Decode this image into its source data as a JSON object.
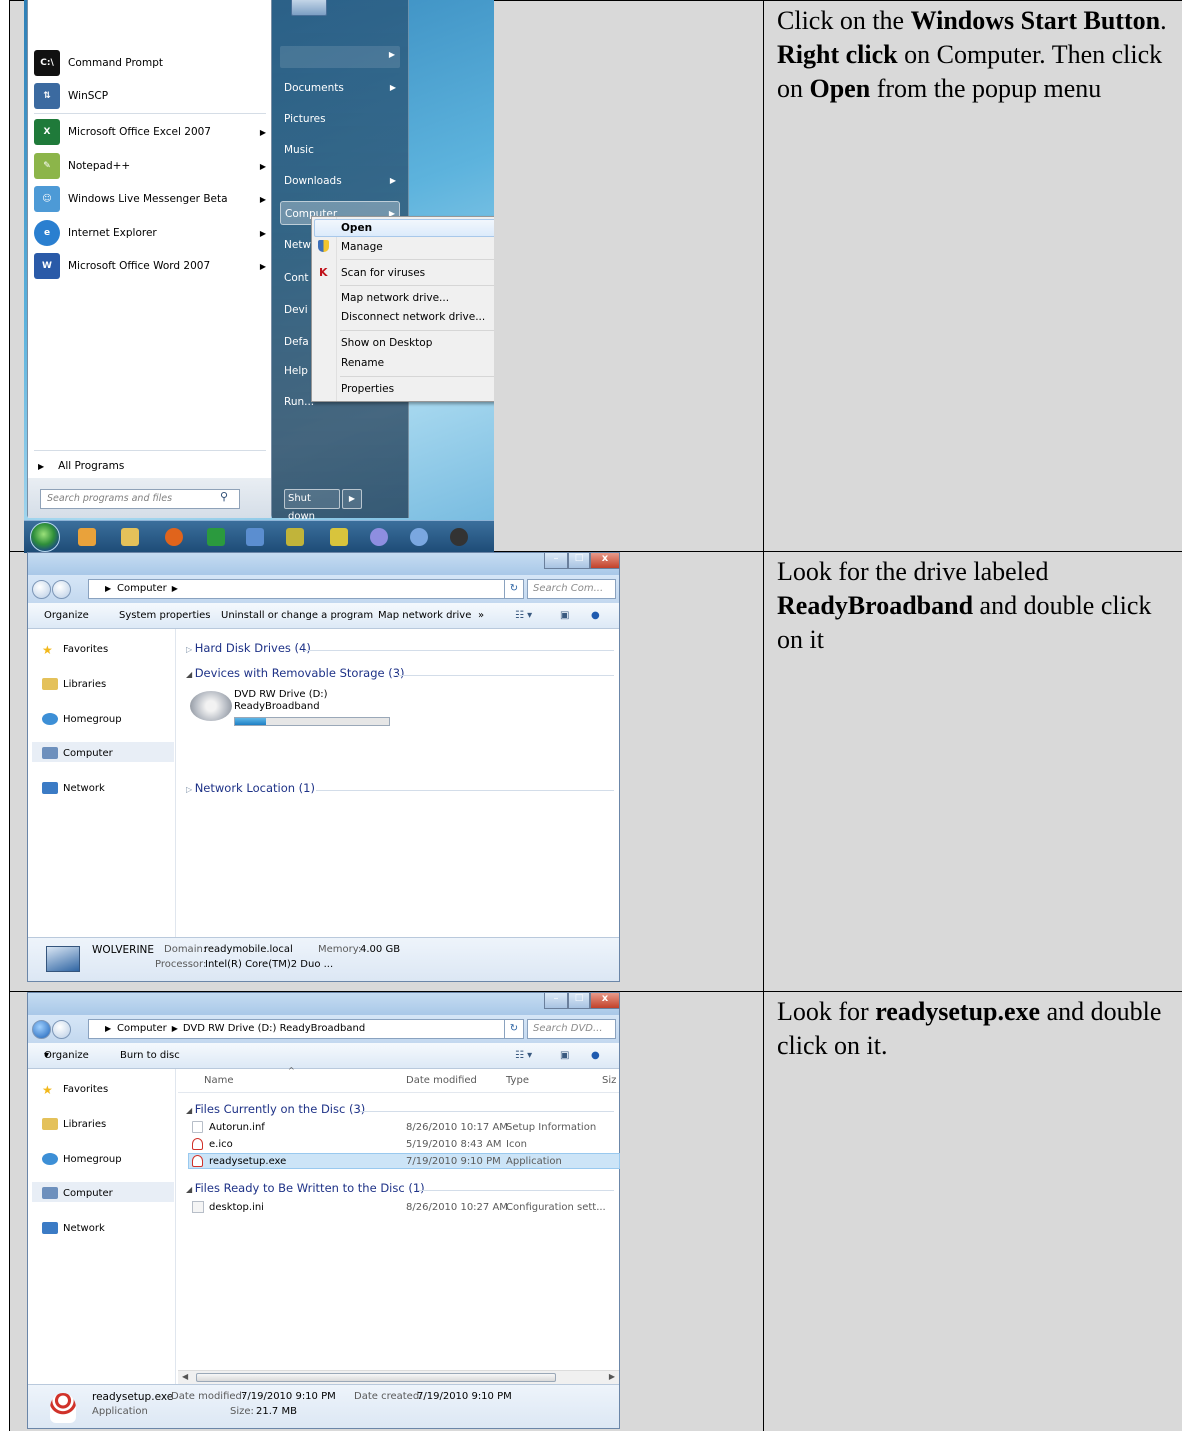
{
  "rows": [
    {
      "instruction_parts": [
        {
          "t": "Click on the ",
          "b": false
        },
        {
          "t": "Windows Start Button",
          "b": true
        },
        {
          "t": ". ",
          "b": false
        },
        {
          "t": "Right click",
          "b": true
        },
        {
          "t": " on Computer. Then click on ",
          "b": false
        },
        {
          "t": "Open",
          "b": true
        },
        {
          "t": " from the popup menu",
          "b": false
        }
      ]
    },
    {
      "instruction_parts": [
        {
          "t": "Look for the drive labeled ",
          "b": false
        },
        {
          "t": "ReadyBroadband",
          "b": true
        },
        {
          "t": " and double click on it",
          "b": false
        }
      ]
    },
    {
      "instruction_parts": [
        {
          "t": "Look for ",
          "b": false
        },
        {
          "t": "readysetup.exe",
          "b": true
        },
        {
          "t": " and double click on it.",
          "b": false
        }
      ]
    }
  ],
  "start_menu": {
    "programs": [
      "Command Prompt",
      "WinSCP",
      "Microsoft Office Excel 2007",
      "Notepad++",
      "Windows Live Messenger Beta",
      "Internet Explorer",
      "Microsoft Office Word 2007"
    ],
    "all_programs": "All Programs",
    "search_placeholder": "Search programs and files",
    "right_links": [
      "Documents",
      "Pictures",
      "Music",
      "Downloads",
      "Computer",
      "Netw",
      "Cont",
      "Devi",
      "Defa",
      "Help",
      "Run..."
    ],
    "shutdown": "Shut down",
    "context_menu": [
      "Open",
      "Manage",
      "Scan for viruses",
      "Map network drive...",
      "Disconnect network drive...",
      "Show on Desktop",
      "Rename",
      "Properties"
    ]
  },
  "explorer1": {
    "address": "Computer",
    "search_placeholder": "Search Com...",
    "toolbar": [
      "Organize",
      "System properties",
      "Uninstall or change a program",
      "Map network drive",
      "»"
    ],
    "nav": [
      "Favorites",
      "Libraries",
      "Homegroup",
      "Computer",
      "Network"
    ],
    "groups": [
      "Hard Disk Drives (4)",
      "Devices with Removable Storage (3)",
      "Network Location (1)"
    ],
    "drive_name": "DVD RW Drive (D:)",
    "drive_label": "ReadyBroadband",
    "drive_fill": 0.2,
    "details_name": "WOLVERINE",
    "details_domain_label": "Domain:",
    "details_domain": "readymobile.local",
    "details_memory_label": "Memory:",
    "details_memory": "4.00 GB",
    "details_processor_label": "Processor:",
    "details_processor": "Intel(R) Core(TM)2 Duo ..."
  },
  "explorer2": {
    "address_parts": [
      "Computer",
      "DVD RW Drive (D:) ReadyBroadband"
    ],
    "search_placeholder": "Search DVD...",
    "toolbar": [
      "Organize",
      "Burn to disc"
    ],
    "nav": [
      "Favorites",
      "Libraries",
      "Homegroup",
      "Computer",
      "Network"
    ],
    "columns": [
      "Name",
      "Date modified",
      "Type",
      "Siz"
    ],
    "group1": "Files Currently on the Disc (3)",
    "group2": "Files Ready to Be Written to the Disc (1)",
    "files": [
      {
        "name": "Autorun.inf",
        "date": "8/26/2010 10:17 AM",
        "type": "Setup Information"
      },
      {
        "name": "e.ico",
        "date": "5/19/2010 8:43 AM",
        "type": "Icon"
      },
      {
        "name": "readysetup.exe",
        "date": "7/19/2010 9:10 PM",
        "type": "Application"
      }
    ],
    "pending": [
      {
        "name": "desktop.ini",
        "date": "8/26/2010 10:27 AM",
        "type": "Configuration sett..."
      }
    ],
    "details_name": "readysetup.exe",
    "details_type": "Application",
    "details_modified_label": "Date modified:",
    "details_modified": "7/19/2010 9:10 PM",
    "details_size_label": "Size:",
    "details_size": "21.7 MB",
    "details_created_label": "Date created:",
    "details_created": "7/19/2010 9:10 PM"
  }
}
